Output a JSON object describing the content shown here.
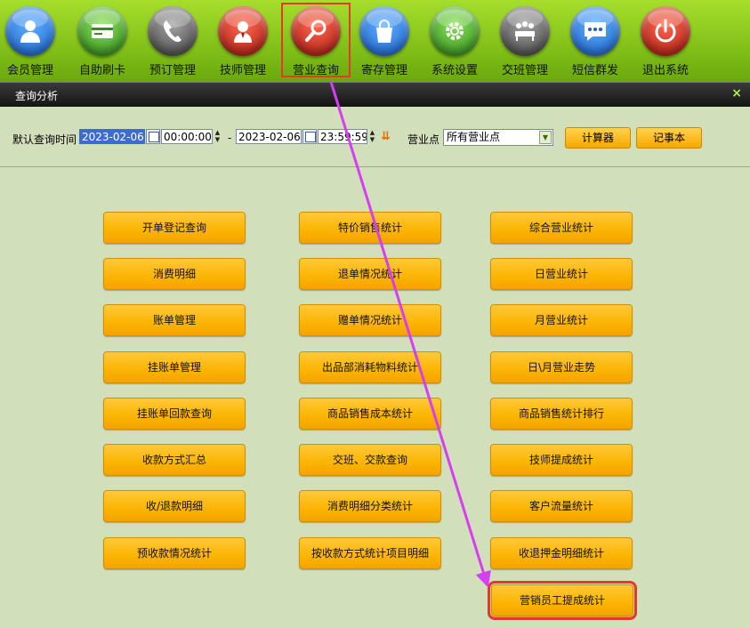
{
  "toolbar": {
    "items": [
      {
        "label": "会员管理",
        "icon": "member-icon",
        "color": "#2a7fe6"
      },
      {
        "label": "自助刷卡",
        "icon": "card-icon",
        "color": "#3fae2c"
      },
      {
        "label": "预订管理",
        "icon": "phone-icon",
        "color": "#6a6a6a"
      },
      {
        "label": "技师管理",
        "icon": "technician-icon",
        "color": "#d8261c"
      },
      {
        "label": "营业查询",
        "icon": "search-icon",
        "color": "#d8261c"
      },
      {
        "label": "寄存管理",
        "icon": "bag-icon",
        "color": "#2a7fe6"
      },
      {
        "label": "系统设置",
        "icon": "gear-icon",
        "color": "#3fae2c"
      },
      {
        "label": "交班管理",
        "icon": "meeting-icon",
        "color": "#6a6a6a"
      },
      {
        "label": "短信群发",
        "icon": "message-icon",
        "color": "#2a7fe6"
      },
      {
        "label": "退出系统",
        "icon": "power-icon",
        "color": "#d8261c"
      }
    ]
  },
  "panel": {
    "title": "查询分析",
    "close": "×"
  },
  "filter": {
    "default_time_label": "默认查询时间",
    "start_date": "2023-02-06",
    "start_time": "00:00:00",
    "separator": "-",
    "end_date": "2023-02-06",
    "end_time": "23:59:59",
    "outlet_label": "营业点",
    "outlet_value": "所有营业点",
    "calculator": "计算器",
    "notepad": "记事本"
  },
  "buttons": {
    "col1": [
      "开单登记查询",
      "消费明细",
      "账单管理",
      "挂账单管理",
      "挂账单回款查询",
      "收款方式汇总",
      "收/退款明细",
      "预收款情况统计"
    ],
    "col2": [
      "特价销售统计",
      "退单情况统计",
      "赠单情况统计",
      "出品部消耗物料统计",
      "商品销售成本统计",
      "交班、交款查询",
      "消费明细分类统计",
      "按收款方式统计项目明细"
    ],
    "col3": [
      "综合营业统计",
      "日营业统计",
      "月营业统计",
      "日\\月营业走势",
      "商品销售统计排行",
      "技师提成统计",
      "客户流量统计",
      "收退押金明细统计",
      "营销员工提成统计"
    ]
  },
  "colors": {
    "accent_orange": "#fbb400",
    "highlight": "#e33a28",
    "arrow": "#d63ff0"
  }
}
